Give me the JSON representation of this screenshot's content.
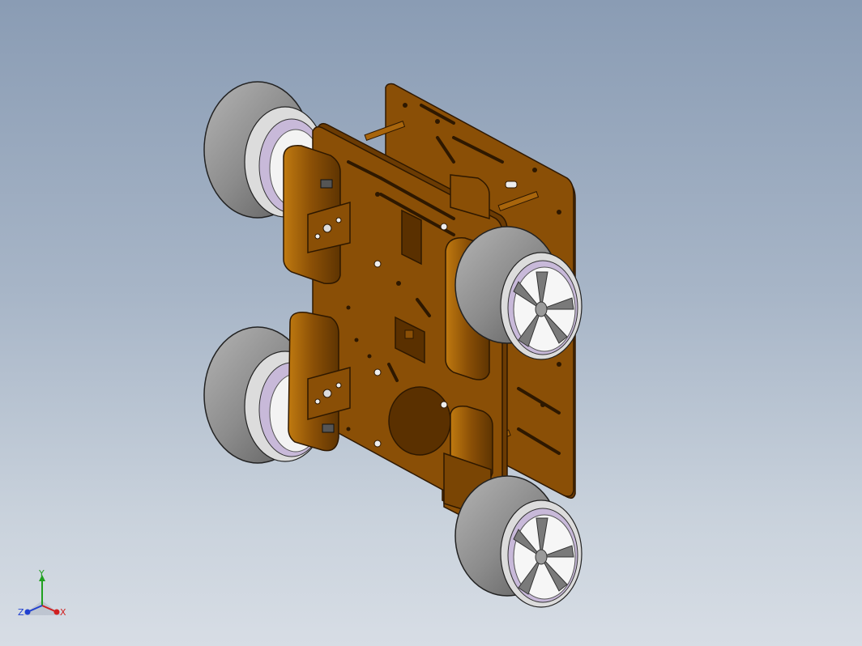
{
  "viewport": {
    "name": "3d-model-viewport",
    "background_top": "#8a9cb4",
    "background_bottom": "#d7dde5"
  },
  "model": {
    "description_colors": {
      "chassis": "#8a4f06",
      "chassis_edge": "#3e2200",
      "chassis_side": "#6b3b03",
      "tire": "#8e8e8e",
      "tire_dark": "#5f5f5f",
      "rim": "#ededed",
      "rim_inner": "#c8b9d9",
      "spoke": "#7a7a7a"
    }
  },
  "triad": {
    "x_label": "X",
    "y_label": "Y",
    "z_label": "Z",
    "x_color": "#d02020",
    "y_color": "#20a020",
    "z_color": "#2040d0"
  }
}
